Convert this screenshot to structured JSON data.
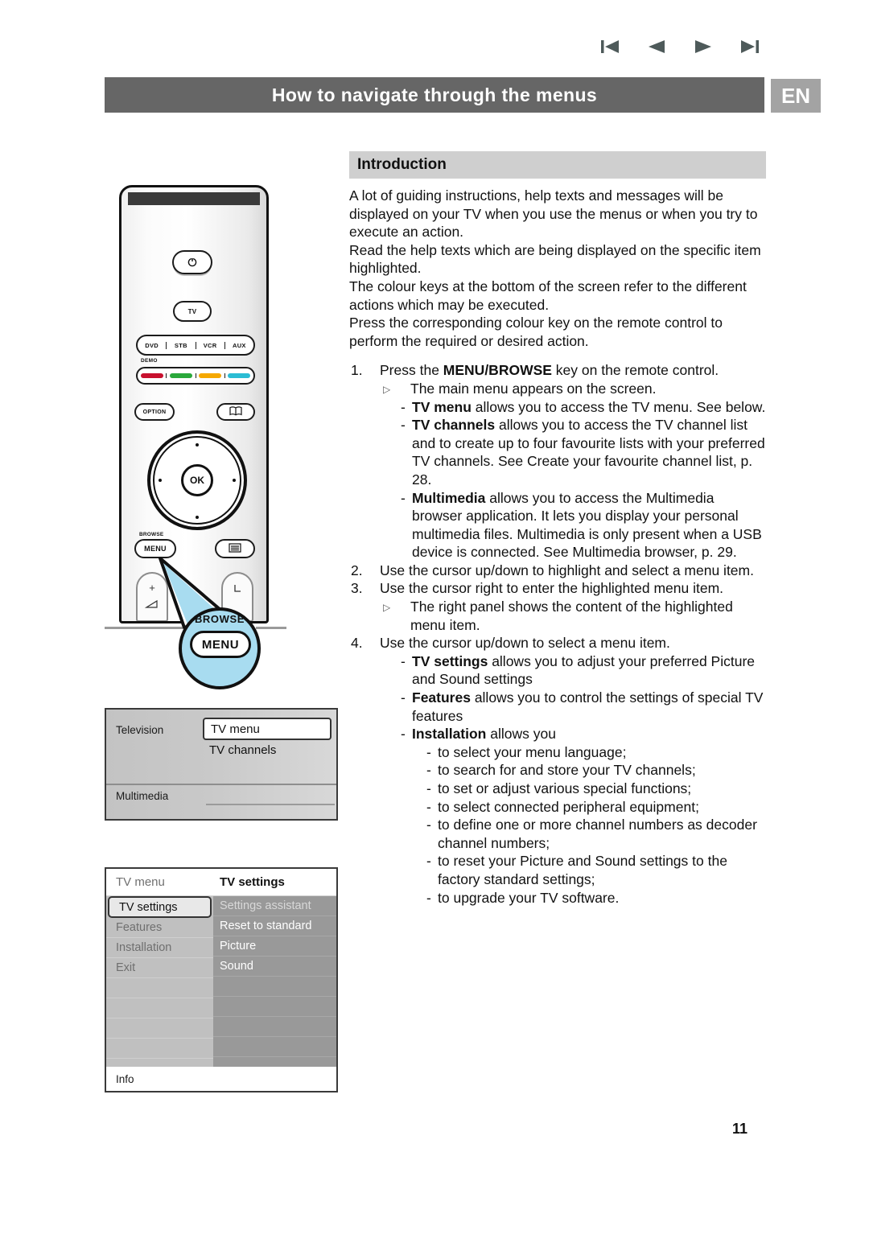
{
  "header": {
    "title": "How to navigate through the menus",
    "language_badge": "EN",
    "nav": [
      {
        "name": "first-page-icon",
        "glyph": "|<"
      },
      {
        "name": "previous-page-icon",
        "glyph": "<"
      },
      {
        "name": "next-page-icon",
        "glyph": ">"
      },
      {
        "name": "last-page-icon",
        "glyph": ">|"
      }
    ]
  },
  "page_number": "11",
  "introduction": {
    "heading": "Introduction",
    "paragraphs": [
      "A lot of guiding instructions, help texts and messages will be displayed on your TV when you use the menus or when you try to execute an action.",
      "Read the help texts which are being displayed on the specific item highlighted.",
      "The colour keys at the bottom of the screen refer to the different actions which may be executed.",
      "Press the corresponding colour key on the remote control to perform the required or desired action."
    ]
  },
  "steps": {
    "step1": {
      "number": "1.",
      "text_before": "Press the ",
      "bold": "MENU/BROWSE",
      "text_after": " key on the remote control.",
      "result": "The main menu appears on the screen.",
      "items": [
        {
          "bold": "TV menu",
          "text": " allows you to access the TV menu. See below."
        },
        {
          "bold": "TV channels",
          "text": " allows you to access the TV channel list and to create up to four favourite lists with your preferred TV channels. See Create your favourite channel list, p. 28."
        },
        {
          "bold": "Multimedia",
          "text": " allows you to access the Multimedia browser application. It lets you display your personal multimedia files. Multimedia is only present when a USB device is connected. See Multimedia browser, p. 29."
        }
      ]
    },
    "step2": {
      "number": "2.",
      "text": "Use the cursor up/down to highlight and select a menu item."
    },
    "step3": {
      "number": "3.",
      "text": "Use the cursor right to enter the highlighted menu item.",
      "result": "The right panel shows the content of the highlighted menu item."
    },
    "step4": {
      "number": "4.",
      "text": "Use the cursor up/down to select a menu item.",
      "items": [
        {
          "bold": "TV settings",
          "text": " allows you to adjust your preferred Picture and Sound settings"
        },
        {
          "bold": "Features",
          "text": " allows you to control the settings of special TV features"
        },
        {
          "bold": "Installation",
          "text": " allows you"
        }
      ],
      "installation_subitems": [
        "to select your menu language;",
        "to search for and store your TV channels;",
        "to set or adjust various special functions;",
        "to select connected peripheral equipment;",
        "to define one or more channel numbers as decoder channel numbers;",
        "to reset your Picture and Sound settings to the factory standard settings;",
        "to upgrade your TV software."
      ]
    }
  },
  "remote": {
    "power_icon": "power-icon",
    "tv_button": "TV",
    "source_buttons": [
      "DVD",
      "STB",
      "VCR",
      "AUX"
    ],
    "demo_label": "DEMO",
    "colour_keys": [
      {
        "name": "red-colour-key",
        "color": "#c8102e"
      },
      {
        "name": "green-colour-key",
        "color": "#2aa83b"
      },
      {
        "name": "yellow-colour-key",
        "color": "#f5a800"
      },
      {
        "name": "cyan-colour-key",
        "color": "#2bbcd4"
      }
    ],
    "option_button": "OPTION",
    "guide_icon": "book-icon",
    "ok_button": "OK",
    "browse_label": "BROWSE",
    "menu_button": "MENU",
    "text_icon": "teletext-icon",
    "volume_plus": "+",
    "volume_icon": "volume-icon",
    "channel_icon": "channel-icon"
  },
  "callout": {
    "browse_label": "BROWSE",
    "menu_label": "MENU",
    "color": "#a8dcf0"
  },
  "menu_screenshot_1": {
    "television_label": "Television",
    "selected_item": "TV menu",
    "second_item": "TV channels",
    "multimedia_label": "Multimedia"
  },
  "menu_screenshot_2": {
    "left_header": "TV menu",
    "right_header": "TV settings",
    "left_items": [
      "TV settings",
      "Features",
      "Installation",
      "Exit"
    ],
    "selected_left_item": "TV settings",
    "right_items": [
      "Settings assistant",
      "Reset to standard",
      "Picture",
      "Sound"
    ],
    "footer": "Info"
  }
}
